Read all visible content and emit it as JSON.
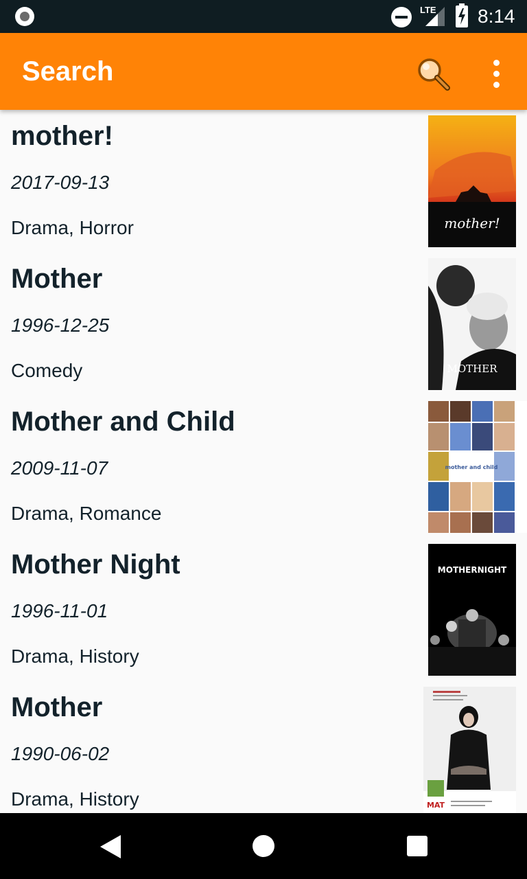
{
  "status_bar": {
    "network_label": "LTE",
    "time": "8:14",
    "icons": [
      "notification-dot-icon",
      "do-not-disturb-icon",
      "signal-icon",
      "battery-charging-icon"
    ]
  },
  "app_bar": {
    "title": "Search",
    "color": "#ff8306",
    "actions": [
      "search-icon",
      "more-vert-icon"
    ]
  },
  "results": [
    {
      "title": "mother!",
      "date": "2017-09-13",
      "genres": "Drama, Horror",
      "poster_text": "mother!"
    },
    {
      "title": "Mother",
      "date": "1996-12-25",
      "genres": "Comedy",
      "poster_text": "MOTHER"
    },
    {
      "title": "Mother and Child",
      "date": "2009-11-07",
      "genres": "Drama, Romance",
      "poster_text": "mother and child"
    },
    {
      "title": "Mother Night",
      "date": "1996-11-01",
      "genres": "Drama, History",
      "poster_text": "MOTHERNIGHT"
    },
    {
      "title": "Mother",
      "date": "1990-06-02",
      "genres": "Drama, History",
      "poster_text": "MAT"
    }
  ],
  "nav_bar": {
    "icons": [
      "back-icon",
      "home-icon",
      "recents-icon"
    ]
  }
}
